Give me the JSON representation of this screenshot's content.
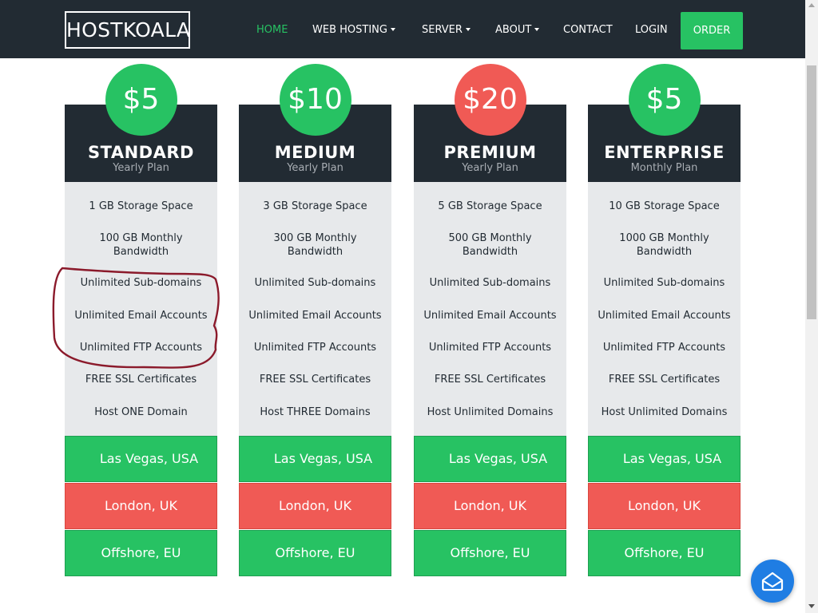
{
  "brand": {
    "logo_text": "HOSTKOALA"
  },
  "nav": {
    "items": [
      {
        "label": "HOME"
      },
      {
        "label": "WEB HOSTING"
      },
      {
        "label": "SERVER"
      },
      {
        "label": "ABOUT"
      },
      {
        "label": "CONTACT"
      },
      {
        "label": "LOGIN"
      }
    ],
    "order_label": "ORDER"
  },
  "colors": {
    "dark": "#222b33",
    "green": "#27c263",
    "red": "#f05a55",
    "feature_bg": "#e7e9eb",
    "annotation": "#8b1a2b",
    "chat": "#1f7de3"
  },
  "plans": [
    {
      "price": "$5",
      "price_color": "green",
      "name": "STANDARD",
      "period": "Yearly Plan",
      "features": [
        "1 GB Storage Space",
        "100 GB Monthly Bandwidth",
        "Unlimited Sub-domains",
        "Unlimited Email Accounts",
        "Unlimited FTP Accounts",
        "FREE SSL Certificates",
        "Host ONE Domain"
      ],
      "locations": [
        "Las Vegas, USA",
        "London, UK",
        "Offshore, EU"
      ]
    },
    {
      "price": "$10",
      "price_color": "green",
      "name": "MEDIUM",
      "period": "Yearly Plan",
      "features": [
        "3 GB Storage Space",
        "300 GB Monthly Bandwidth",
        "Unlimited Sub-domains",
        "Unlimited Email Accounts",
        "Unlimited FTP Accounts",
        "FREE SSL Certificates",
        "Host THREE Domains"
      ],
      "locations": [
        "Las Vegas, USA",
        "London, UK",
        "Offshore, EU"
      ]
    },
    {
      "price": "$20",
      "price_color": "red",
      "name": "PREMIUM",
      "period": "Yearly Plan",
      "features": [
        "5 GB Storage Space",
        "500 GB Monthly Bandwidth",
        "Unlimited Sub-domains",
        "Unlimited Email Accounts",
        "Unlimited FTP Accounts",
        "FREE SSL Certificates",
        "Host Unlimited Domains"
      ],
      "locations": [
        "Las Vegas, USA",
        "London, UK",
        "Offshore, EU"
      ]
    },
    {
      "price": "$5",
      "price_color": "green",
      "name": "ENTERPRISE",
      "period": "Monthly Plan",
      "features": [
        "10 GB Storage Space",
        "1000 GB Monthly Bandwidth",
        "Unlimited Sub-domains",
        "Unlimited Email Accounts",
        "Unlimited FTP Accounts",
        "FREE SSL Certificates",
        "Host Unlimited Domains"
      ],
      "locations": [
        "Las Vegas, USA",
        "London, UK",
        "Offshore, EU"
      ]
    }
  ],
  "icons": {
    "nav_dropdown": "caret-down-icon",
    "chat": "envelope-icon",
    "scroll_up": "scroll-up-arrow-icon",
    "scroll_down": "scroll-down-arrow-icon"
  }
}
